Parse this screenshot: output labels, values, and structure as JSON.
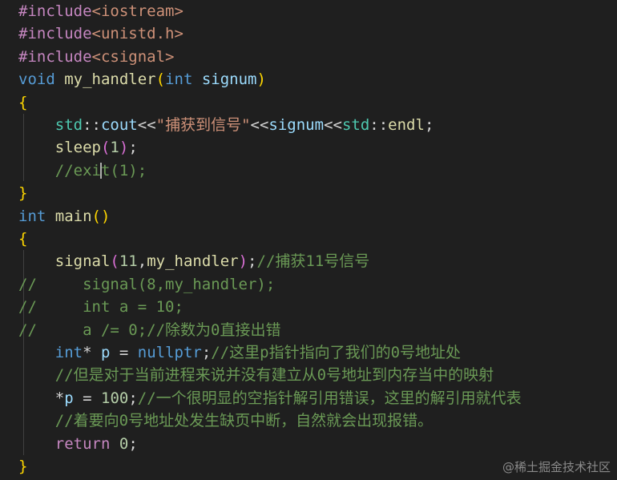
{
  "editor": {
    "lines": [
      [
        {
          "t": "#include",
          "c": "tok-pp"
        },
        {
          "t": "<iostream>",
          "c": "tok-header"
        }
      ],
      [
        {
          "t": "#include",
          "c": "tok-pp"
        },
        {
          "t": "<unistd.h>",
          "c": "tok-header"
        }
      ],
      [
        {
          "t": "#include",
          "c": "tok-pp"
        },
        {
          "t": "<csignal>",
          "c": "tok-header"
        }
      ],
      [
        {
          "t": "void",
          "c": "tok-kw"
        },
        {
          "t": " ",
          "c": "tok-punc"
        },
        {
          "t": "my_handler",
          "c": "tok-fn"
        },
        {
          "t": "(",
          "c": "tok-brace1"
        },
        {
          "t": "int",
          "c": "tok-kw"
        },
        {
          "t": " ",
          "c": "tok-punc"
        },
        {
          "t": "signum",
          "c": "tok-param"
        },
        {
          "t": ")",
          "c": "tok-brace1"
        }
      ],
      [
        {
          "t": "{",
          "c": "tok-brace1"
        }
      ],
      [
        {
          "t": "    ",
          "c": "tok-punc"
        },
        {
          "t": "std",
          "c": "tok-ns"
        },
        {
          "t": "::",
          "c": "tok-punc"
        },
        {
          "t": "cout",
          "c": "tok-var"
        },
        {
          "t": "<<",
          "c": "tok-punc"
        },
        {
          "t": "\"捕获到信号\"",
          "c": "tok-str"
        },
        {
          "t": "<<",
          "c": "tok-punc"
        },
        {
          "t": "signum",
          "c": "tok-param"
        },
        {
          "t": "<<",
          "c": "tok-punc"
        },
        {
          "t": "std",
          "c": "tok-ns"
        },
        {
          "t": "::",
          "c": "tok-punc"
        },
        {
          "t": "endl",
          "c": "tok-fn"
        },
        {
          "t": ";",
          "c": "tok-punc"
        }
      ],
      [
        {
          "t": "    ",
          "c": "tok-punc"
        },
        {
          "t": "sleep",
          "c": "tok-fn"
        },
        {
          "t": "(",
          "c": "tok-paren2"
        },
        {
          "t": "1",
          "c": "tok-num"
        },
        {
          "t": ")",
          "c": "tok-paren2"
        },
        {
          "t": ";",
          "c": "tok-punc"
        }
      ],
      [
        {
          "t": "    ",
          "c": "tok-punc"
        },
        {
          "t": "//exi",
          "c": "tok-com"
        },
        {
          "t": "|",
          "c": "cursor"
        },
        {
          "t": "t(1);",
          "c": "tok-com"
        }
      ],
      [
        {
          "t": "}",
          "c": "tok-brace1"
        }
      ],
      [
        {
          "t": "int",
          "c": "tok-kw"
        },
        {
          "t": " ",
          "c": "tok-punc"
        },
        {
          "t": "main",
          "c": "tok-fn"
        },
        {
          "t": "()",
          "c": "tok-brace1"
        }
      ],
      [
        {
          "t": "{",
          "c": "tok-brace1"
        }
      ],
      [
        {
          "t": "    ",
          "c": "tok-punc"
        },
        {
          "t": "signal",
          "c": "tok-fn"
        },
        {
          "t": "(",
          "c": "tok-paren2"
        },
        {
          "t": "11",
          "c": "tok-num"
        },
        {
          "t": ",",
          "c": "tok-punc"
        },
        {
          "t": "my_handler",
          "c": "tok-fn"
        },
        {
          "t": ")",
          "c": "tok-paren2"
        },
        {
          "t": ";",
          "c": "tok-punc"
        },
        {
          "t": "//捕获11号信号",
          "c": "tok-com"
        }
      ],
      [
        {
          "t": "//     signal(8,my_handler);",
          "c": "tok-com"
        }
      ],
      [
        {
          "t": "//     int a = 10;",
          "c": "tok-com"
        }
      ],
      [
        {
          "t": "//     a /= 0;//除数为0直接出错",
          "c": "tok-com"
        }
      ],
      [
        {
          "t": "    ",
          "c": "tok-punc"
        },
        {
          "t": "int",
          "c": "tok-kw"
        },
        {
          "t": "* ",
          "c": "tok-punc"
        },
        {
          "t": "p",
          "c": "tok-var"
        },
        {
          "t": " = ",
          "c": "tok-punc"
        },
        {
          "t": "nullptr",
          "c": "tok-kw"
        },
        {
          "t": ";",
          "c": "tok-punc"
        },
        {
          "t": "//这里p指针指向了我们的0号地址处",
          "c": "tok-com"
        }
      ],
      [
        {
          "t": "    ",
          "c": "tok-punc"
        },
        {
          "t": "//但是对于当前进程来说并没有建立从0号地址到内存当中的映射",
          "c": "tok-com"
        }
      ],
      [
        {
          "t": "    ",
          "c": "tok-punc"
        },
        {
          "t": "*",
          "c": "tok-punc"
        },
        {
          "t": "p",
          "c": "tok-var"
        },
        {
          "t": " = ",
          "c": "tok-punc"
        },
        {
          "t": "100",
          "c": "tok-num"
        },
        {
          "t": ";",
          "c": "tok-punc"
        },
        {
          "t": "//一个很明显的空指针解引用错误，这里的解引用就代表",
          "c": "tok-com"
        }
      ],
      [
        {
          "t": "    ",
          "c": "tok-punc"
        },
        {
          "t": "//着要向0号地址处发生缺页中断，自然就会出现报错。",
          "c": "tok-com"
        }
      ],
      [
        {
          "t": "    ",
          "c": "tok-punc"
        },
        {
          "t": "return",
          "c": "tok-ctl"
        },
        {
          "t": " ",
          "c": "tok-punc"
        },
        {
          "t": "0",
          "c": "tok-num"
        },
        {
          "t": ";",
          "c": "tok-punc"
        }
      ],
      [
        {
          "t": "}",
          "c": "tok-brace1"
        }
      ]
    ]
  },
  "watermark": "@稀土掘金技术社区"
}
